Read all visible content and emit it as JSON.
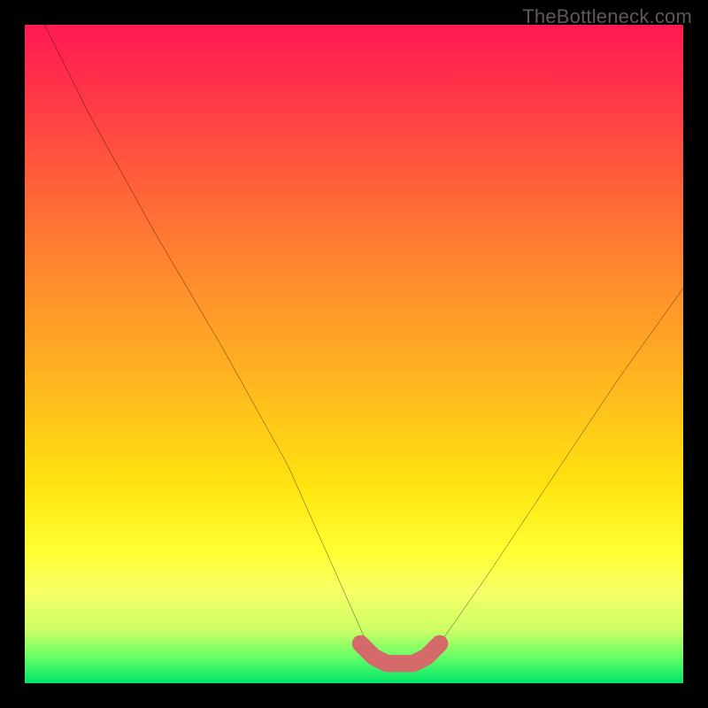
{
  "watermark": "TheBottleneck.com",
  "chart_data": {
    "type": "line",
    "title": "",
    "xlabel": "",
    "ylabel": "",
    "x_range": [
      0,
      100
    ],
    "y_range": [
      0,
      100
    ],
    "series": [
      {
        "name": "bottleneck-curve",
        "x": [
          3,
          10,
          20,
          30,
          40,
          48,
          52,
          55,
          60,
          63,
          70,
          80,
          90,
          100
        ],
        "y": [
          100,
          86,
          68,
          51,
          33,
          15,
          6,
          3,
          3,
          6,
          16,
          31,
          46,
          60
        ]
      }
    ],
    "highlight": {
      "name": "optimal-band",
      "x": [
        51,
        53,
        55,
        57,
        59,
        61,
        63
      ],
      "y": [
        6,
        4,
        3,
        3,
        3,
        4,
        6
      ]
    },
    "gradient_stops": [
      {
        "pos": 0,
        "color": "#ff1a53"
      },
      {
        "pos": 22,
        "color": "#ff5a3c"
      },
      {
        "pos": 55,
        "color": "#ffb81f"
      },
      {
        "pos": 80,
        "color": "#ffff33"
      },
      {
        "pos": 96,
        "color": "#66ff66"
      },
      {
        "pos": 100,
        "color": "#00e56b"
      }
    ]
  }
}
